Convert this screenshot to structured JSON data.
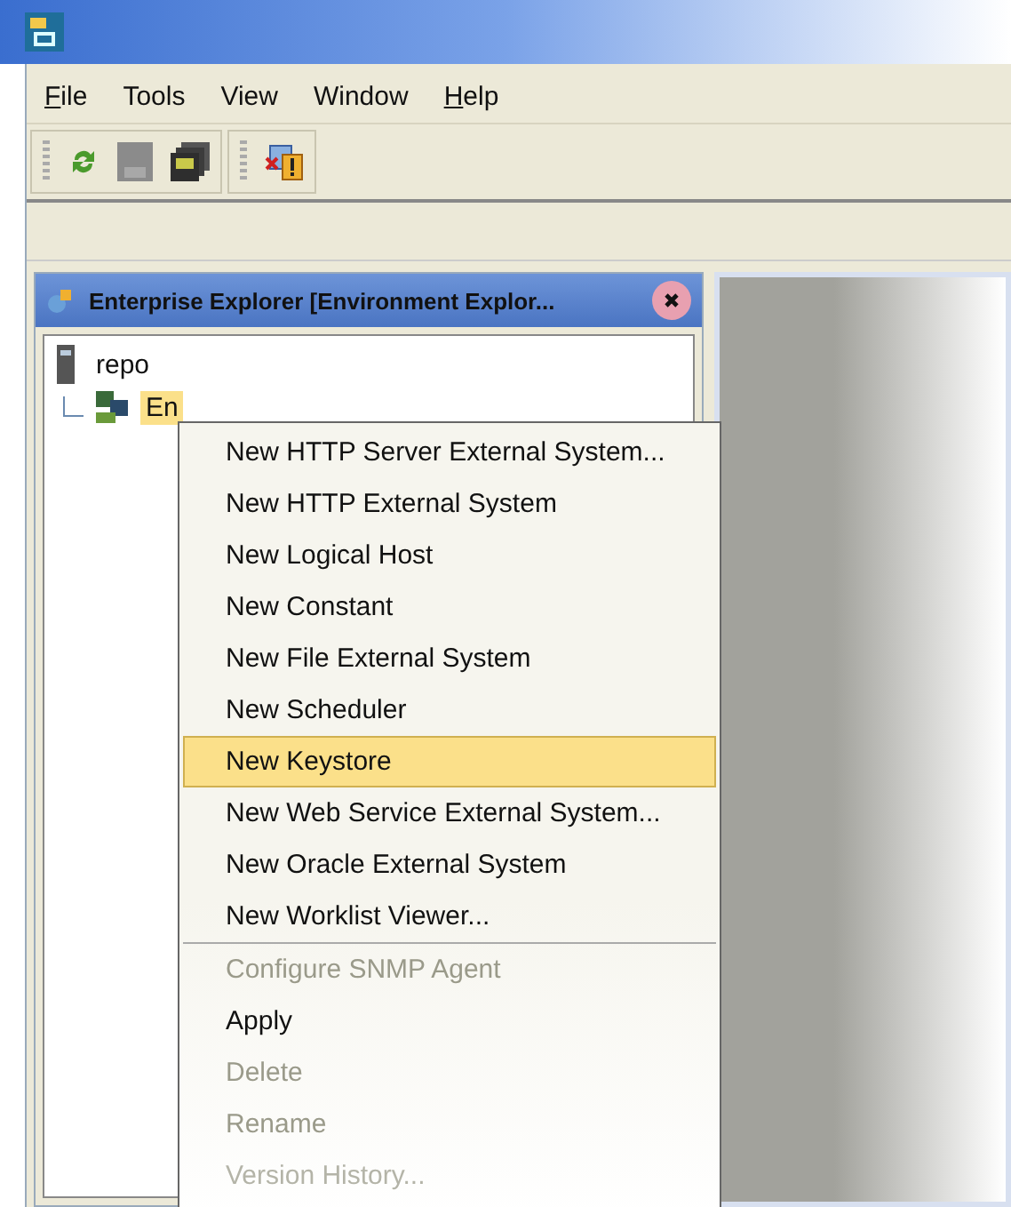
{
  "menu_bar": [
    {
      "label": "File",
      "mnemonic": true
    },
    {
      "label": "Tools",
      "mnemonic": false
    },
    {
      "label": "View",
      "mnemonic": false
    },
    {
      "label": "Window",
      "mnemonic": false
    },
    {
      "label": "Help",
      "mnemonic": true
    }
  ],
  "panel": {
    "title": "Enterprise Explorer [Environment Explor..."
  },
  "tree": [
    {
      "label": "repo",
      "kind": "repository",
      "selected": false,
      "children": [
        {
          "label": "En",
          "kind": "environment",
          "selected": true
        }
      ]
    }
  ],
  "context_menu": [
    {
      "label": "New HTTP Server External System...",
      "selected": false,
      "disabled": false
    },
    {
      "label": "New HTTP External System",
      "selected": false,
      "disabled": false
    },
    {
      "label": "New Logical Host",
      "selected": false,
      "disabled": false
    },
    {
      "label": "New Constant",
      "selected": false,
      "disabled": false
    },
    {
      "label": "New File External System",
      "selected": false,
      "disabled": false
    },
    {
      "label": "New Scheduler",
      "selected": false,
      "disabled": false
    },
    {
      "label": "New Keystore",
      "selected": true,
      "disabled": false
    },
    {
      "label": "New Web Service External System...",
      "selected": false,
      "disabled": false
    },
    {
      "label": "New Oracle External System",
      "selected": false,
      "disabled": false
    },
    {
      "label": "New Worklist Viewer...",
      "selected": false,
      "disabled": false,
      "separator_after": true
    },
    {
      "label": "Configure SNMP Agent",
      "selected": false,
      "disabled": true
    },
    {
      "label": "Apply",
      "selected": false,
      "disabled": false
    },
    {
      "label": "Delete",
      "selected": false,
      "disabled": true
    },
    {
      "label": "Rename",
      "selected": false,
      "disabled": true
    },
    {
      "label": "Version History...",
      "selected": false,
      "disabled": true
    }
  ]
}
